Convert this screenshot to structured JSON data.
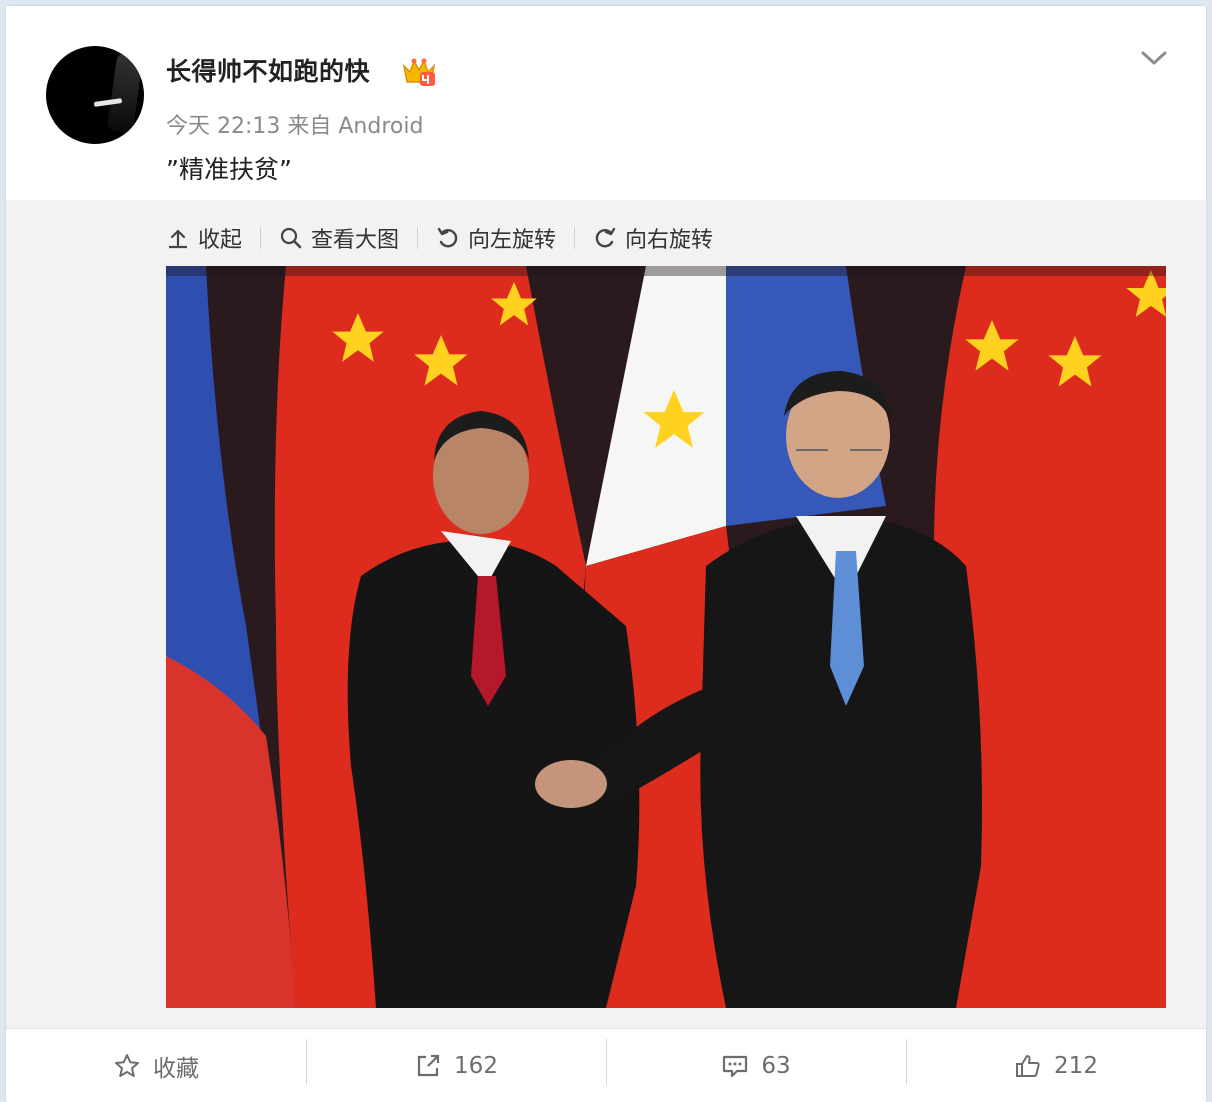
{
  "post": {
    "username": "长得帅不如跑的快",
    "meta": "今天 22:13 来自 Android",
    "text": "”精准扶贫”"
  },
  "toolbar": {
    "collapse": "收起",
    "view_large": "查看大图",
    "rotate_left": "向左旋转",
    "rotate_right": "向右旋转"
  },
  "footer": {
    "favorite": "收藏",
    "reposts": "162",
    "comments": "63",
    "likes": "212"
  },
  "icons": {
    "collapse": "arrow-up-icon",
    "view_large": "search-icon",
    "rotate_left": "rotate-left-icon",
    "rotate_right": "rotate-right-icon",
    "favorite": "star-icon",
    "repost": "share-icon",
    "comment": "comment-icon",
    "like": "thumbs-up-icon",
    "more": "chevron-down-icon",
    "vip": "crown-badge-icon"
  },
  "colors": {
    "page_bg": "#dfe8f0",
    "card_bg": "#ffffff",
    "media_bg": "#f2f2f5",
    "meta_text": "#8a8a8a",
    "footer_text": "#6d6d6d"
  }
}
